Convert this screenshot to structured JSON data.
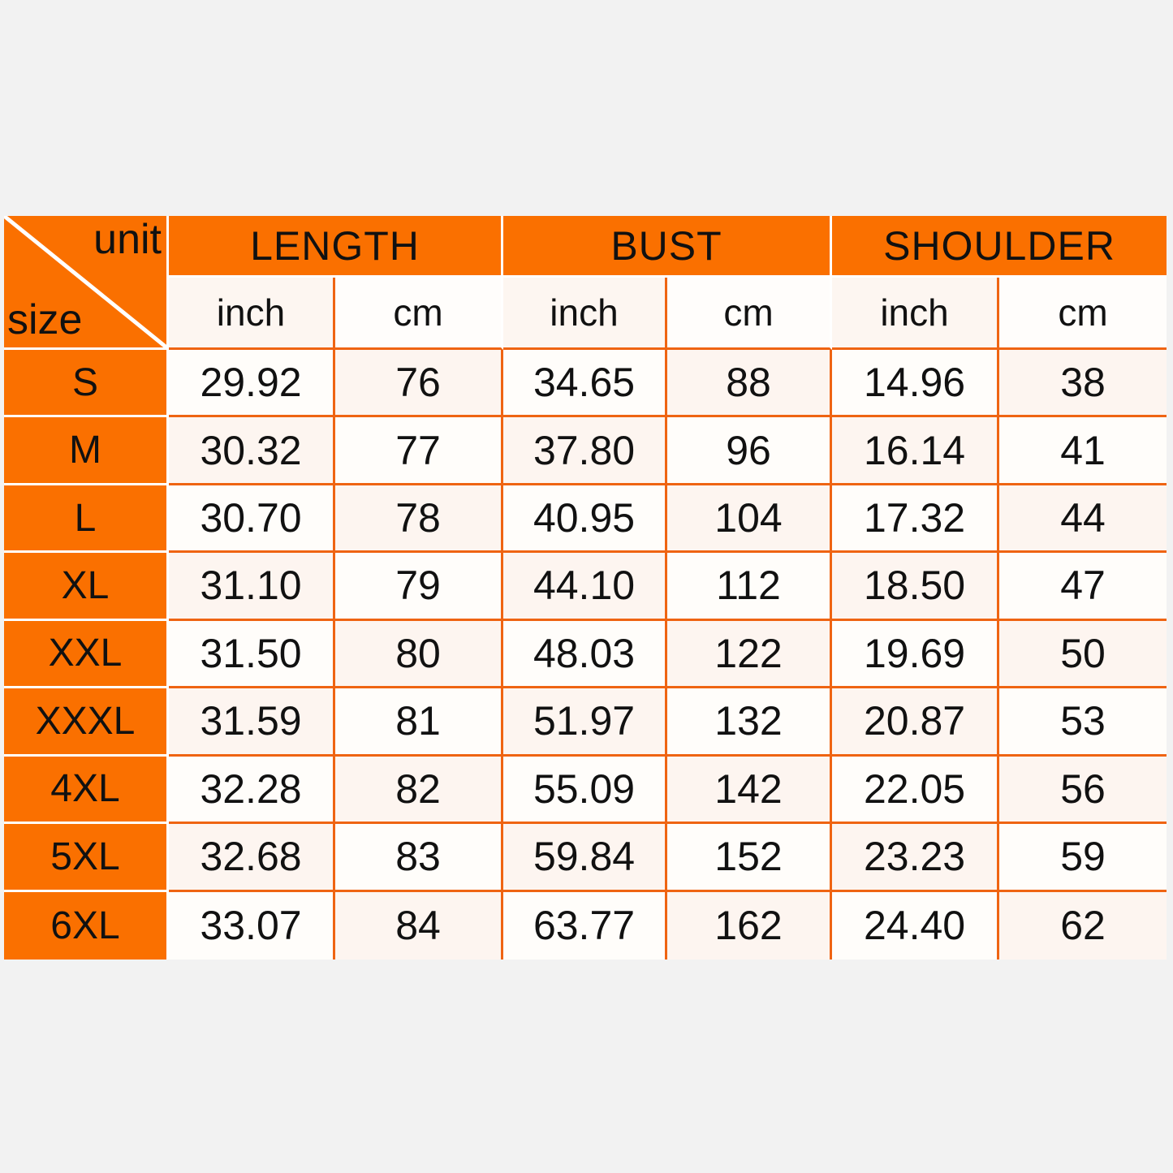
{
  "theme": {
    "accent": "#fa7000",
    "grid_line": "#ef6412",
    "separator": "#ffffff",
    "cell_tint_a": "#fdf5f0",
    "cell_tint_b": "#fffdfa",
    "page_background": "#f2f2f2",
    "text": "#111111"
  },
  "corner": {
    "unit_label": "unit",
    "size_label": "size"
  },
  "groups": [
    {
      "name": "LENGTH"
    },
    {
      "name": "BUST"
    },
    {
      "name": "SHOULDER"
    }
  ],
  "units": [
    "inch",
    "cm",
    "inch",
    "cm",
    "inch",
    "cm"
  ],
  "chart_data": {
    "type": "table",
    "title": "",
    "row_header": "size",
    "col_header": "unit",
    "column_groups": [
      "LENGTH",
      "BUST",
      "SHOULDER"
    ],
    "sub_columns": [
      "inch",
      "cm",
      "inch",
      "cm",
      "inch",
      "cm"
    ],
    "categories": [
      "S",
      "M",
      "L",
      "XL",
      "XXL",
      "XXXL",
      "4XL",
      "5XL",
      "6XL"
    ],
    "rows": [
      {
        "size": "S",
        "length_inch": "29.92",
        "length_cm": "76",
        "bust_inch": "34.65",
        "bust_cm": "88",
        "shoulder_inch": "14.96",
        "shoulder_cm": "38"
      },
      {
        "size": "M",
        "length_inch": "30.32",
        "length_cm": "77",
        "bust_inch": "37.80",
        "bust_cm": "96",
        "shoulder_inch": "16.14",
        "shoulder_cm": "41"
      },
      {
        "size": "L",
        "length_inch": "30.70",
        "length_cm": "78",
        "bust_inch": "40.95",
        "bust_cm": "104",
        "shoulder_inch": "17.32",
        "shoulder_cm": "44"
      },
      {
        "size": "XL",
        "length_inch": "31.10",
        "length_cm": "79",
        "bust_inch": "44.10",
        "bust_cm": "112",
        "shoulder_inch": "18.50",
        "shoulder_cm": "47"
      },
      {
        "size": "XXL",
        "length_inch": "31.50",
        "length_cm": "80",
        "bust_inch": "48.03",
        "bust_cm": "122",
        "shoulder_inch": "19.69",
        "shoulder_cm": "50"
      },
      {
        "size": "XXXL",
        "length_inch": "31.59",
        "length_cm": "81",
        "bust_inch": "51.97",
        "bust_cm": "132",
        "shoulder_inch": "20.87",
        "shoulder_cm": "53"
      },
      {
        "size": "4XL",
        "length_inch": "32.28",
        "length_cm": "82",
        "bust_inch": "55.09",
        "bust_cm": "142",
        "shoulder_inch": "22.05",
        "shoulder_cm": "56"
      },
      {
        "size": "5XL",
        "length_inch": "32.68",
        "length_cm": "83",
        "bust_inch": "59.84",
        "bust_cm": "152",
        "shoulder_inch": "23.23",
        "shoulder_cm": "59"
      },
      {
        "size": "6XL",
        "length_inch": "33.07",
        "length_cm": "84",
        "bust_inch": "63.77",
        "bust_cm": "162",
        "shoulder_inch": "24.40",
        "shoulder_cm": "62"
      }
    ]
  }
}
